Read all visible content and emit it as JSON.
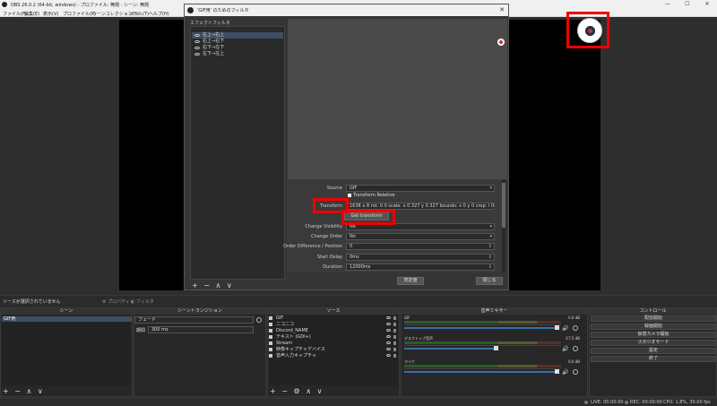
{
  "window": {
    "title": "OBS 26.0.2 (64-bit, windows) - プロファイル: 無題 - シーン: 無題",
    "minimize": "—",
    "maximize": "☐",
    "close": "✕"
  },
  "menu": [
    "ファイル(F)",
    "編集(E)",
    "表示(V)",
    "プロファイル(P)",
    "シーンコレクション(S)",
    "ツール(T)",
    "ヘルプ(H)"
  ],
  "dialog": {
    "title": "'GIF用' のためのフィルタ",
    "effect_filters_label": "エフェクトフィルタ",
    "filters": [
      "左上→右上",
      "右上→右下",
      "右下→左下",
      "左下→左上"
    ],
    "list_buttons": "+ − ∧ ∨",
    "transform_relative": "Transform Relative",
    "get_transform_button": "Get transform",
    "reset_button": "既定値",
    "close_button": "閉じる",
    "properties": [
      {
        "label": "Source",
        "value": "GIF"
      },
      {
        "label": "Transform",
        "value": "1638 x 8 rot: 0.0 scale: x 0.327 y 0.327 bounds: x 0 y 0 crop: l 0 t 0 r 0 b 0"
      },
      {
        "label": "Change Visibility",
        "value": "No"
      },
      {
        "label": "Change Order",
        "value": "No"
      },
      {
        "label": "Order Difference / Position",
        "value": "0"
      },
      {
        "label": "Start Delay",
        "value": "0ms"
      },
      {
        "label": "Duration",
        "value": "12000ms"
      },
      {
        "label": "Easing",
        "value": ""
      }
    ]
  },
  "status_strip": {
    "no_source": "ソースが選択されていません",
    "properties": "プロパティ",
    "filters": "フィルタ"
  },
  "docks": {
    "scenes": {
      "header": "シーン",
      "items": [
        "GIF用"
      ],
      "footer": "+ − ∧ ∨"
    },
    "transitions": {
      "header": "シーントランジション",
      "selected": "フェード",
      "duration_label": "期間",
      "duration_value": "300 ms"
    },
    "sources": {
      "header": "ソース",
      "items": [
        "GIF",
        "ニコニコ",
        "Discord_NAME",
        "テキスト (GDI+)",
        "Stream",
        "映像キャプチャデバイス",
        "音声入力キャプチャ"
      ],
      "footer": "+ − ⚙ ∧ ∨"
    },
    "mixer": {
      "header": "音声ミキサー",
      "channels": [
        {
          "name": "GIF",
          "db": "0.0 dB",
          "level": 1.0
        },
        {
          "name": "デスクトップ音声",
          "db": "-17.5 dB",
          "level": 0.6
        },
        {
          "name": "マイク",
          "db": "0.0 dB",
          "level": 1.0
        }
      ]
    },
    "controls": {
      "header": "コントロール",
      "buttons": [
        "配信開始",
        "録画開始",
        "仮想カメラ開始",
        "スタジオモード",
        "設定",
        "終了"
      ]
    }
  },
  "statusbar": {
    "live": "LIVE: 00:00:00",
    "rec": "REC: 00:00:00",
    "cpu": "CPU: 1.8%, 30.00 fps"
  }
}
